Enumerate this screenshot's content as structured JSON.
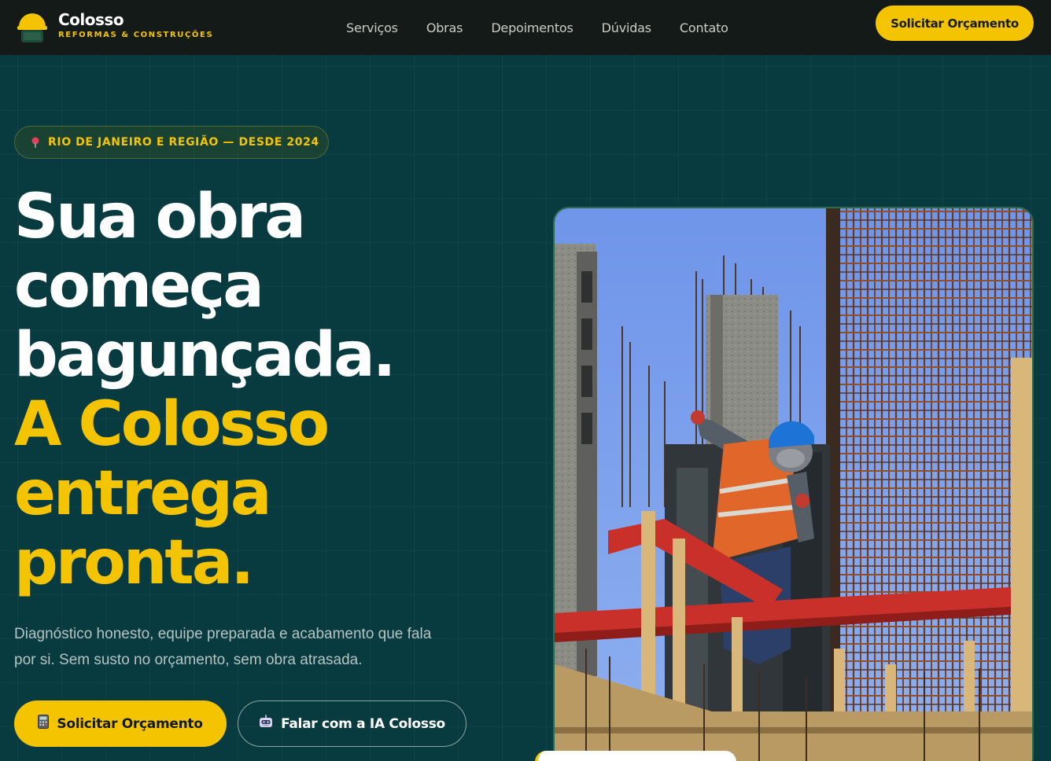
{
  "colors": {
    "accent": "#f5c400",
    "background": "#083b40",
    "navbar": "#141a17"
  },
  "navbar": {
    "logo_icon": "hard-hat-icon",
    "brand_name": "Colosso",
    "brand_tagline": "REFORMAS & CONSTRUÇÕES",
    "links": [
      "Serviços",
      "Obras",
      "Depoimentos",
      "Dúvidas",
      "Contato"
    ],
    "cta_label": "Solicitar Orçamento"
  },
  "hero": {
    "badge_icon": "map-pin-icon",
    "badge_text": "RIO DE JANEIRO E REGIÃO — DESDE 2024",
    "headline_lines": [
      "Sua obra",
      "começa",
      "bagunçada."
    ],
    "headline_accent_lines": [
      "A Colosso",
      "entrega",
      "pronta."
    ],
    "lede": "Diagnóstico honesto, equipe preparada e acabamento que fala por si. Sem susto no orçamento, sem obra atrasada.",
    "primary_cta_icon": "calculator-icon",
    "primary_cta": "Solicitar Orçamento",
    "secondary_cta_icon": "robot-icon",
    "secondary_cta": "Falar com a IA Colosso",
    "photo_icon": "construction-worker-photo"
  }
}
